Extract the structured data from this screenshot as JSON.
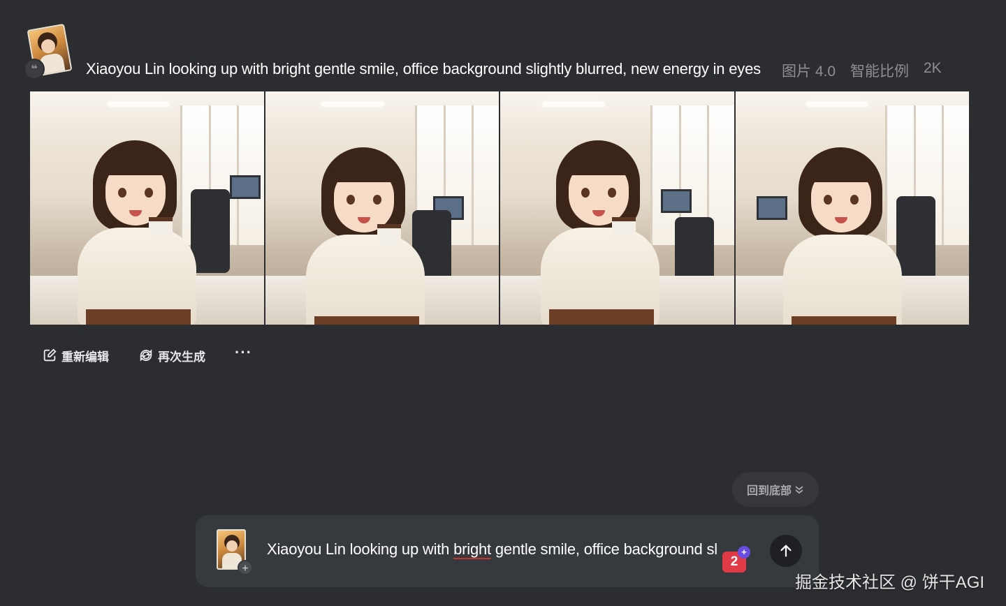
{
  "prompt": {
    "text": "Xiaoyou Lin looking up with bright gentle smile, office background slightly blurred, new energy in eyes",
    "model": "图片 4.0",
    "ratio": "智能比例",
    "resolution": "2K",
    "quote_icon": "quote-icon"
  },
  "images": [
    {
      "alt": "generated image 1"
    },
    {
      "alt": "generated image 2"
    },
    {
      "alt": "generated image 3"
    },
    {
      "alt": "generated image 4"
    }
  ],
  "actions": {
    "reedit_label": "重新编辑",
    "regenerate_label": "再次生成",
    "more_label": "···"
  },
  "back_to_bottom": {
    "label": "回到底部",
    "icon": "chevron-double-down-icon"
  },
  "composer": {
    "text_before": "Xiaoyou Lin looking up with ",
    "underlined_word": "bright",
    "text_after": " gentle smile, office background sl",
    "add_label": "+",
    "grammar_count": "2",
    "grammar_plus": "+",
    "send_icon": "arrow-up-icon"
  },
  "watermark": "掘金技术社区 @ 饼干AGI",
  "colors": {
    "background": "#2b2d30",
    "composer": "#36393d",
    "meta_text": "#8d8f94",
    "grammar_red": "#e03a46",
    "underline_red": "#c9312b"
  }
}
